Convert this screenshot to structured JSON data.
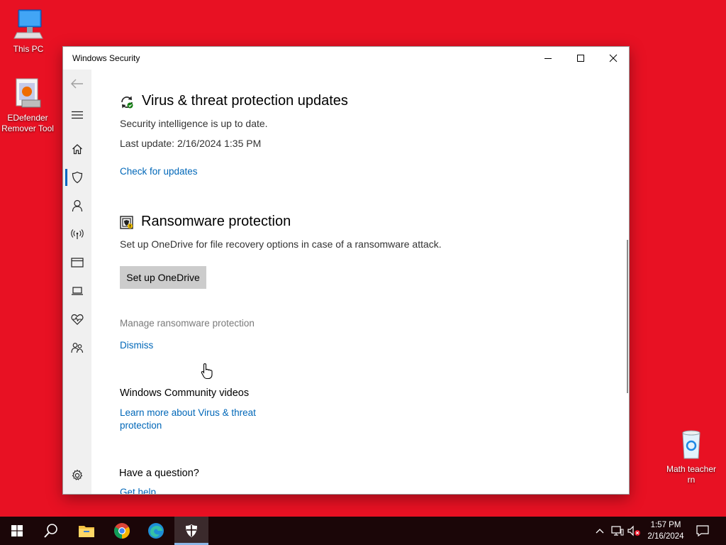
{
  "desktop": {
    "icons": [
      {
        "label": "This PC"
      },
      {
        "label": "EDefender Remover Tool"
      },
      {
        "label": "Math teacher rn"
      }
    ]
  },
  "window": {
    "title": "Windows Security"
  },
  "content": {
    "updates": {
      "heading": "Virus & threat protection updates",
      "status": "Security intelligence is up to date.",
      "last_update": "Last update: 2/16/2024 1:35 PM",
      "check_link": "Check for updates"
    },
    "ransomware": {
      "heading": "Ransomware protection",
      "description": "Set up OneDrive for file recovery options in case of a ransomware attack.",
      "setup_button": "Set up OneDrive",
      "manage_link": "Manage ransomware protection",
      "dismiss_link": "Dismiss"
    },
    "community": {
      "heading": "Windows Community videos",
      "link_line1": "Learn more about Virus & threat",
      "link_line2": "protection"
    },
    "question": {
      "heading": "Have a question?",
      "help_link": "Get help"
    }
  },
  "taskbar": {
    "time": "1:57 PM",
    "date": "2/16/2024"
  },
  "colors": {
    "desktop_bg": "#e81123",
    "link": "#0067b8",
    "accent": "#0067c0",
    "taskbar": "#1b0608"
  }
}
